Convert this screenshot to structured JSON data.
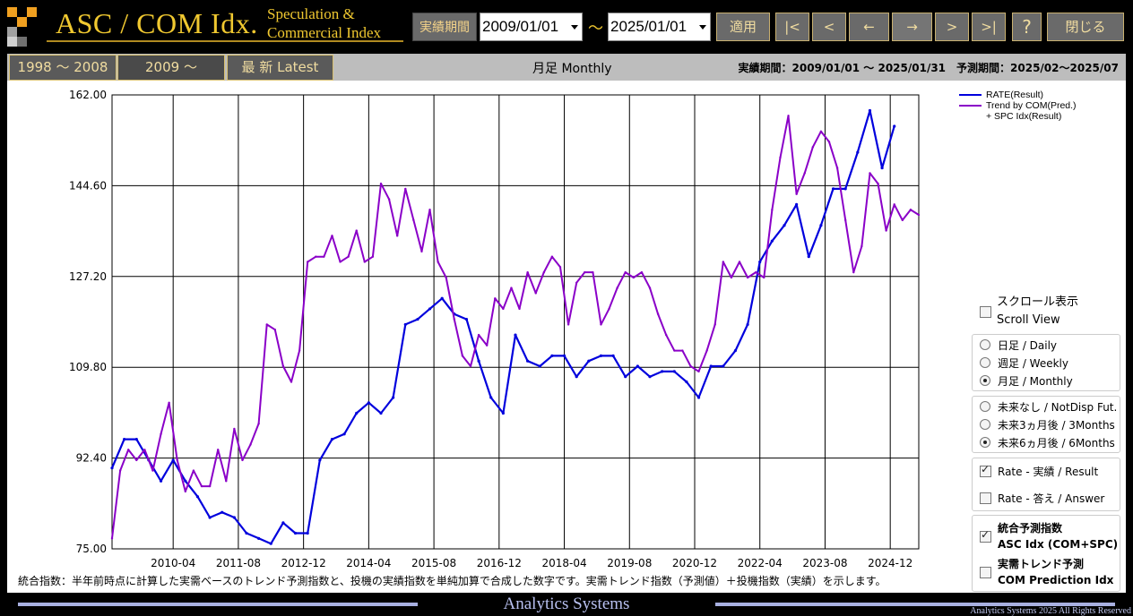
{
  "header": {
    "title": "ASC / COM Idx.",
    "subtitle_line1": "Speculation &",
    "subtitle_line2": "Commercial Index",
    "period_label": "実績期間",
    "start_date": "2009/01/01",
    "end_date": "2025/01/01",
    "range_separator": "～",
    "apply_label": "適用",
    "first_label": "|<",
    "prev_label": "<",
    "back_label": "←",
    "forward_label": "→",
    "next_label": ">",
    "last_label": ">|",
    "help_label": "?",
    "close_label": "閉じる"
  },
  "tabs": {
    "items": [
      "1998 ～ 2008",
      "2009 ～",
      "最 新  Latest"
    ],
    "active_index": 1,
    "center_label": "月足 Monthly",
    "info_text": "実績期間：2009/01/01 ～ 2025/01/31　予測期間：2025/02～2025/07"
  },
  "legend": {
    "rate": "RATE(Result)",
    "trend_line1": "Trend by COM(Pred.)",
    "trend_line2": "+ SPC Idx(Result)"
  },
  "options": {
    "scroll_jp": "スクロール表示",
    "scroll_en": "Scroll View",
    "daily": "日足 / Daily",
    "weekly": "週足 / Weekly",
    "monthly": "月足 / Monthly",
    "future_none": "未来なし / NotDisp Fut.",
    "future_3m": "未来3ヵ月後 / 3Months",
    "future_6m": "未来6ヵ月後 / 6Months",
    "rate_result": "Rate - 実績 / Result",
    "rate_answer": "Rate - 答え / Answer",
    "asc_jp": "統合予測指数",
    "asc_en": "ASC Idx (COM+SPC)",
    "com_jp": "実需トレンド予測",
    "com_en": "COM Prediction Idx"
  },
  "footnote": "統合指数：半年前時点に計算した実需ベースのトレンド予測指数と、投機の実績指数を単純加算で合成した数字です。実需トレンド指数（予測値）＋投機指数（実績）を示します。",
  "footer": {
    "title": "Analytics Systems",
    "copyright": "Analytics Systems 2025 All Rights Reserved"
  },
  "colors": {
    "rate": "#0000dd",
    "trend": "#8a00c8",
    "accent": "#f0c830"
  },
  "chart_data": {
    "type": "line",
    "xlabel": "",
    "ylabel": "",
    "ylim": [
      75.0,
      162.0
    ],
    "y_ticks": [
      "162.00",
      "144.60",
      "127.20",
      "109.80",
      "92.40",
      "75.00"
    ],
    "x_ticks": [
      "2010-04",
      "2011-08",
      "2012-12",
      "2014-04",
      "2015-08",
      "2016-12",
      "2018-04",
      "2019-08",
      "2020-12",
      "2022-04",
      "2023-08",
      "2024-12"
    ],
    "x_range": [
      "2009-01",
      "2025-07"
    ],
    "grid": true,
    "legend_position": "top-right",
    "series": [
      {
        "name": "RATE(Result)",
        "x": [
          "2009-01",
          "2009-04",
          "2009-07",
          "2009-10",
          "2010-01",
          "2010-04",
          "2010-07",
          "2010-10",
          "2011-01",
          "2011-04",
          "2011-07",
          "2011-10",
          "2012-01",
          "2012-04",
          "2012-07",
          "2012-10",
          "2013-01",
          "2013-04",
          "2013-07",
          "2013-10",
          "2014-01",
          "2014-04",
          "2014-07",
          "2014-10",
          "2015-01",
          "2015-04",
          "2015-07",
          "2015-10",
          "2016-01",
          "2016-04",
          "2016-07",
          "2016-10",
          "2017-01",
          "2017-04",
          "2017-07",
          "2017-10",
          "2018-01",
          "2018-04",
          "2018-07",
          "2018-10",
          "2019-01",
          "2019-04",
          "2019-07",
          "2019-10",
          "2020-01",
          "2020-04",
          "2020-07",
          "2020-10",
          "2021-01",
          "2021-04",
          "2021-07",
          "2021-10",
          "2022-01",
          "2022-04",
          "2022-07",
          "2022-10",
          "2023-01",
          "2023-04",
          "2023-07",
          "2023-10",
          "2024-01",
          "2024-04",
          "2024-07",
          "2024-10",
          "2025-01"
        ],
        "values": [
          90.5,
          96,
          96,
          92,
          88,
          92,
          88,
          85,
          81,
          82,
          81,
          78,
          77,
          76,
          80,
          78,
          78,
          92,
          96,
          97,
          101,
          103,
          101,
          104,
          118,
          119,
          121,
          123,
          120,
          119,
          111,
          104,
          101,
          116,
          111,
          110,
          112,
          112,
          108,
          111,
          112,
          112,
          108,
          110,
          108,
          109,
          109,
          107,
          104,
          110,
          110,
          113,
          118,
          130,
          134,
          137,
          141,
          131,
          137,
          144,
          144,
          151,
          159,
          148,
          156
        ]
      },
      {
        "name": "Trend by COM(Pred.) + SPC Idx(Result)",
        "x": [
          "2009-01",
          "2009-03",
          "2009-05",
          "2009-07",
          "2009-09",
          "2009-11",
          "2010-01",
          "2010-03",
          "2010-05",
          "2010-07",
          "2010-09",
          "2010-11",
          "2011-01",
          "2011-03",
          "2011-05",
          "2011-07",
          "2011-09",
          "2011-11",
          "2012-01",
          "2012-03",
          "2012-05",
          "2012-07",
          "2012-09",
          "2012-11",
          "2013-01",
          "2013-03",
          "2013-05",
          "2013-07",
          "2013-09",
          "2013-11",
          "2014-01",
          "2014-03",
          "2014-05",
          "2014-07",
          "2014-09",
          "2014-11",
          "2015-01",
          "2015-03",
          "2015-05",
          "2015-07",
          "2015-09",
          "2015-11",
          "2016-01",
          "2016-03",
          "2016-05",
          "2016-07",
          "2016-09",
          "2016-11",
          "2017-01",
          "2017-03",
          "2017-05",
          "2017-07",
          "2017-09",
          "2017-11",
          "2018-01",
          "2018-03",
          "2018-05",
          "2018-07",
          "2018-09",
          "2018-11",
          "2019-01",
          "2019-03",
          "2019-05",
          "2019-07",
          "2019-09",
          "2019-11",
          "2020-01",
          "2020-03",
          "2020-05",
          "2020-07",
          "2020-09",
          "2020-11",
          "2021-01",
          "2021-03",
          "2021-05",
          "2021-07",
          "2021-09",
          "2021-11",
          "2022-01",
          "2022-03",
          "2022-05",
          "2022-07",
          "2022-09",
          "2022-11",
          "2023-01",
          "2023-03",
          "2023-05",
          "2023-07",
          "2023-09",
          "2023-11",
          "2024-01",
          "2024-03",
          "2024-05",
          "2024-07",
          "2024-09",
          "2024-11",
          "2025-01",
          "2025-03",
          "2025-05",
          "2025-07"
        ],
        "values": [
          77,
          90,
          94,
          92,
          94,
          90,
          97,
          103,
          92,
          86,
          90,
          87,
          87,
          94,
          88,
          98,
          92,
          95,
          99,
          118,
          117,
          110,
          107,
          113,
          130,
          131,
          131,
          135,
          130,
          131,
          136,
          130,
          131,
          145,
          142,
          135,
          144,
          138,
          132,
          140,
          130,
          127,
          119,
          112,
          110,
          116,
          114,
          123,
          121,
          125,
          121,
          128,
          124,
          128,
          131,
          129,
          118,
          126,
          128,
          128,
          118,
          121,
          125,
          128,
          127,
          128,
          125,
          120,
          116,
          113,
          113,
          110,
          109,
          113,
          118,
          130,
          127,
          130,
          127,
          128,
          127,
          140,
          150,
          158,
          143,
          147,
          152,
          155,
          153,
          148,
          138,
          128,
          133,
          147,
          145,
          136,
          141,
          138,
          140,
          139
        ]
      }
    ]
  }
}
